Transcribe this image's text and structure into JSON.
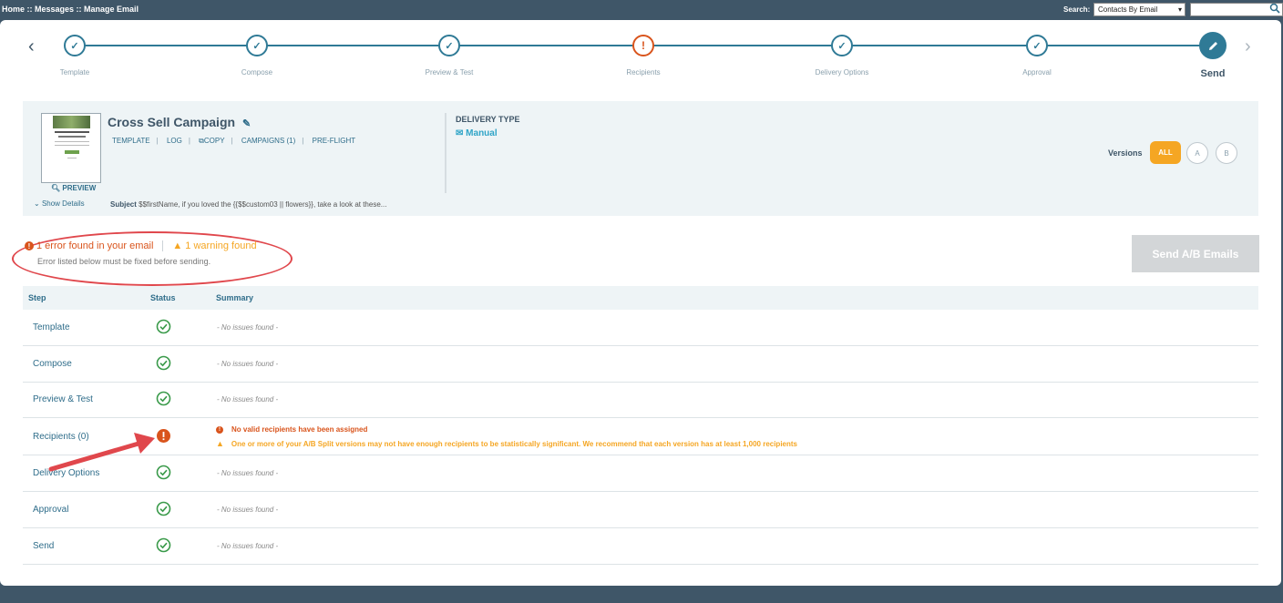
{
  "topbar": {
    "breadcrumb": "Home :: Messages :: Manage Email",
    "search_label": "Search:",
    "search_select": "Contacts By Email"
  },
  "stepper": {
    "steps": [
      {
        "label": "Template",
        "state": "done"
      },
      {
        "label": "Compose",
        "state": "done"
      },
      {
        "label": "Preview & Test",
        "state": "done"
      },
      {
        "label": "Recipients",
        "state": "error"
      },
      {
        "label": "Delivery Options",
        "state": "done"
      },
      {
        "label": "Approval",
        "state": "done"
      },
      {
        "label": "Send",
        "state": "active"
      }
    ]
  },
  "campaign": {
    "title": "Cross Sell Campaign",
    "links": [
      "TEMPLATE",
      "LOG",
      "COPY",
      "CAMPAIGNS (1)",
      "PRE-FLIGHT"
    ],
    "preview_label": "PREVIEW",
    "show_details": "Show Details",
    "subject_label": "Subject",
    "subject_value": "$$firstName, if you loved the {{$$custom03 || flowers}}, take a look at these...",
    "delivery_type_label": "DELIVERY TYPE",
    "delivery_type_value": "Manual",
    "versions_label": "Versions",
    "versions": [
      "ALL",
      "A",
      "B"
    ]
  },
  "validation": {
    "error_text": "1 error found in your email",
    "warning_text": "1 warning found",
    "sub_text": "Error listed below must be fixed before sending.",
    "send_button": "Send A/B Emails"
  },
  "table": {
    "headers": {
      "step": "Step",
      "status": "Status",
      "summary": "Summary"
    },
    "rows": [
      {
        "step": "Template",
        "status": "ok",
        "summary": "- No issues found -"
      },
      {
        "step": "Compose",
        "status": "ok",
        "summary": "- No issues found -"
      },
      {
        "step": "Preview & Test",
        "status": "ok",
        "summary": "- No issues found -"
      },
      {
        "step": "Recipients (0)",
        "status": "error",
        "error": "No valid recipients have been assigned",
        "warning": "One or more of your A/B Split versions may not have enough recipients to be statistically significant. We recommend that each version has at least 1,000 recipients"
      },
      {
        "step": "Delivery Options",
        "status": "ok",
        "summary": "- No issues found -"
      },
      {
        "step": "Approval",
        "status": "ok",
        "summary": "- No issues found -"
      },
      {
        "step": "Send",
        "status": "ok",
        "summary": "- No issues found -"
      }
    ]
  },
  "colors": {
    "primary": "#2f7a96",
    "error": "#d9541c",
    "warning": "#f5a623",
    "success": "#3a9a4a",
    "annotation": "#e0474c"
  }
}
